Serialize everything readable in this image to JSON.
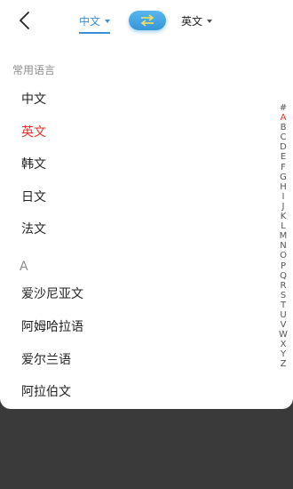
{
  "header": {
    "source_lang": "中文",
    "target_lang": "英文"
  },
  "sections": [
    {
      "title": "常用语言",
      "items": [
        "中文",
        "英文",
        "韩文",
        "日文",
        "法文"
      ]
    },
    {
      "title": "A",
      "items": [
        "爱沙尼亚文",
        "阿姆哈拉语",
        "爱尔兰语",
        "阿拉伯文"
      ]
    }
  ],
  "selected_language": "英文",
  "alpha_index": [
    "#",
    "A",
    "B",
    "C",
    "D",
    "E",
    "F",
    "G",
    "H",
    "I",
    "J",
    "K",
    "L",
    "M",
    "N",
    "O",
    "P",
    "Q",
    "R",
    "S",
    "T",
    "U",
    "V",
    "W",
    "X",
    "Y",
    "Z"
  ],
  "active_index": "A",
  "colors": {
    "accent": "#3a8fd6",
    "selected": "#e2302b",
    "backdrop": "#3a3a3a"
  }
}
